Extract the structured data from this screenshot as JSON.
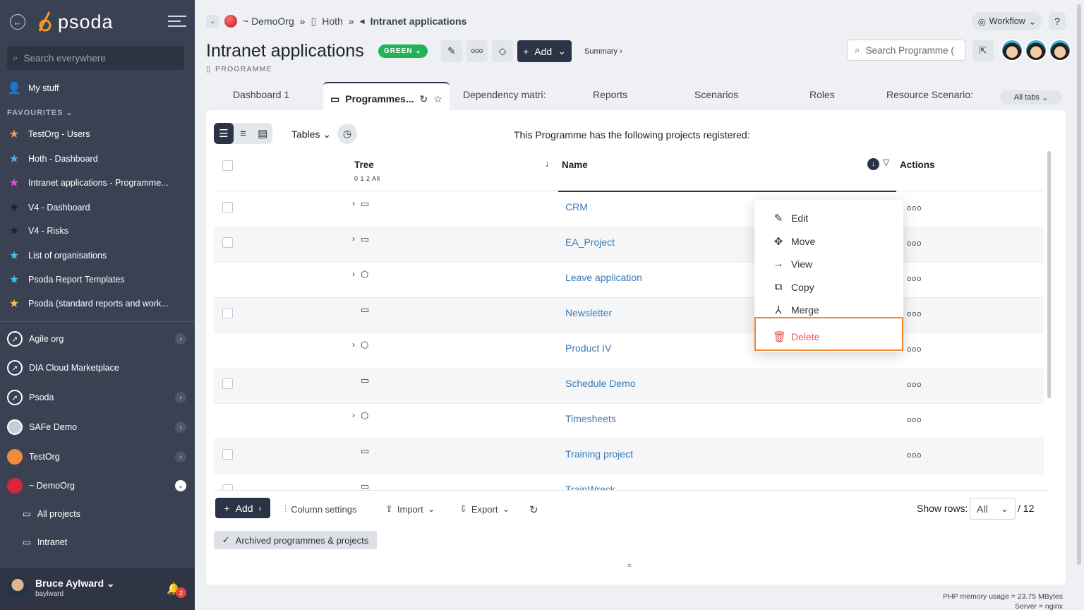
{
  "sidebar": {
    "logo": "psoda",
    "search_placeholder": "Search everywhere",
    "my_stuff": "My stuff",
    "favourites_header": "FAVOURITES",
    "favourites": [
      {
        "label": "TestOrg - Users",
        "star": "orange"
      },
      {
        "label": "Hoth - Dashboard",
        "star": "blue"
      },
      {
        "label": "Intranet applications - Programme...",
        "star": "pink"
      },
      {
        "label": "V4 - Dashboard",
        "star": "dark"
      },
      {
        "label": "V4 - Risks",
        "star": "dark"
      },
      {
        "label": "List of organisations",
        "star": "cyan"
      },
      {
        "label": "Psoda Report Templates",
        "star": "cyan"
      },
      {
        "label": "Psoda (standard reports and work...",
        "star": "yellow"
      }
    ],
    "orgs": [
      {
        "label": "Agile org"
      },
      {
        "label": "DIA Cloud Marketplace"
      },
      {
        "label": "Psoda"
      },
      {
        "label": "SAFe Demo"
      },
      {
        "label": "TestOrg"
      },
      {
        "label": "~ DemoOrg"
      }
    ],
    "sub_items": [
      "All projects",
      "Intranet"
    ],
    "user": {
      "name": "Bruce Aylward",
      "handle": "baylward",
      "notifications": "2"
    }
  },
  "breadcrumb": {
    "org": "~ DemoOrg",
    "parent": "Hoth",
    "current": "Intranet applications",
    "sep": "»"
  },
  "header": {
    "workflow": "Workflow",
    "help": "?",
    "title": "Intranet applications",
    "status": "GREEN",
    "add_label": "Add",
    "summary": "Summary ›",
    "type_label": "PROGRAMME",
    "search_placeholder": "Search Programme (",
    "colors": {
      "status_green": "#22b257",
      "dark_navy": "#2b3447",
      "delete_red": "#e05a4f",
      "highlight_orange": "#f08a2d"
    }
  },
  "tabs": [
    "Dashboard 1",
    "Programmes...",
    "Dependency matri:",
    "Reports",
    "Scenarios",
    "Roles",
    "Resource Scenario:"
  ],
  "all_tabs": "All tabs",
  "toolbar": {
    "tables": "Tables",
    "intro": "This Programme has the following projects registered:"
  },
  "grid": {
    "col_tree": "Tree",
    "col_tree_levels": "0 1 2 All",
    "col_name": "Name",
    "col_actions": "Actions",
    "rows": [
      {
        "name": "CRM",
        "expand": "›",
        "icon": "▭",
        "checkbox": true
      },
      {
        "name": "EA_Project",
        "expand": "›",
        "icon": "▭",
        "checkbox": true
      },
      {
        "name": "Leave application",
        "expand": "›",
        "icon": "⬡",
        "checkbox": false
      },
      {
        "name": "Newsletter",
        "expand": "",
        "icon": "▭",
        "checkbox": true
      },
      {
        "name": "Product IV",
        "expand": "›",
        "icon": "⬡",
        "checkbox": false
      },
      {
        "name": "Schedule Demo",
        "expand": "",
        "icon": "▭",
        "checkbox": true
      },
      {
        "name": "Timesheets",
        "expand": "›",
        "icon": "⬡",
        "checkbox": false
      },
      {
        "name": "Training project",
        "expand": "",
        "icon": "▭",
        "checkbox": true
      },
      {
        "name": "TrainWreck",
        "expand": "",
        "icon": "▭",
        "checkbox": true
      }
    ],
    "actions_glyph": "ooo"
  },
  "footer": {
    "add": "Add",
    "column_settings": "Column settings",
    "import": "Import",
    "export": "Export",
    "show_rows": "Show rows:",
    "rows_value": "All",
    "rows_total": "/ 12",
    "archived": "Archived programmes & projects"
  },
  "context_menu": [
    "Edit",
    "Move",
    "View",
    "Copy",
    "Merge",
    "Delete"
  ],
  "server_info": {
    "memory": "PHP memory usage = 23.75 MBytes",
    "server": "Server = nginx"
  }
}
